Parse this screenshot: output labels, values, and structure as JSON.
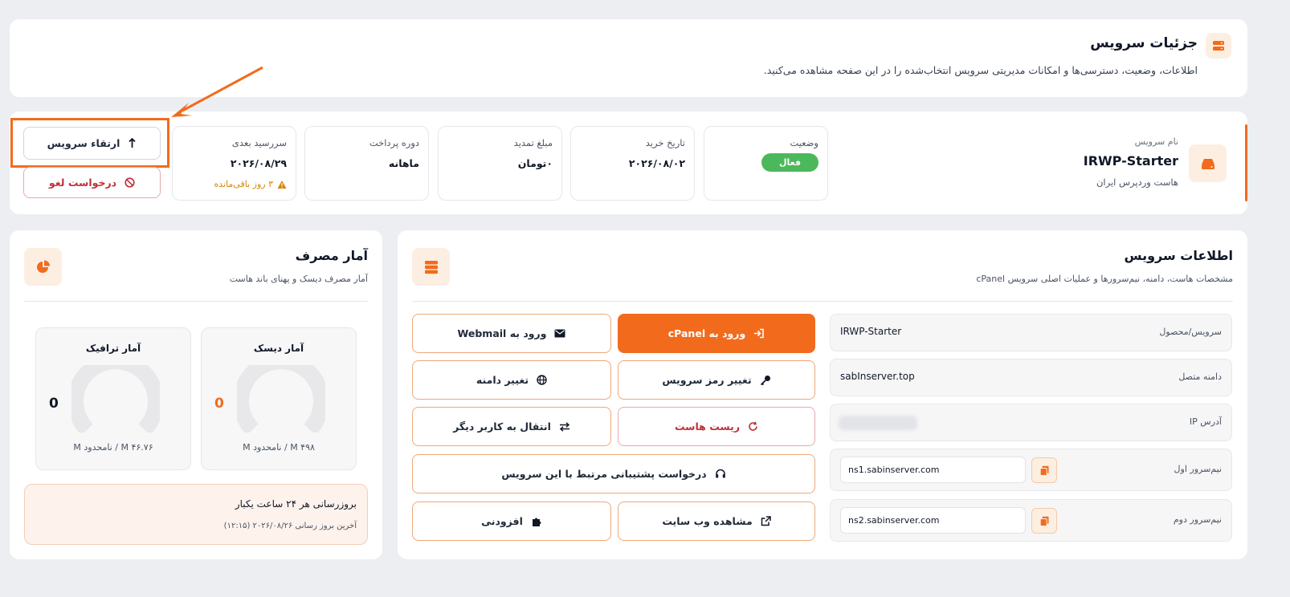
{
  "header": {
    "title": "جزئیات سرویس",
    "subtitle": "اطلاعات، وضعیت، دسترسی‌ها و امکانات مدیریتی سرویس انتخاب‌شده را در این صفحه مشاهده می‌کنید."
  },
  "service": {
    "name_label": "نام سرویس",
    "name": "IRWP-Starter",
    "type": "هاست وردپرس ایران",
    "status_label": "وضعیت",
    "status": "فعال",
    "purchase_label": "تاریخ خرید",
    "purchase_date": "۲۰۲۶/۰۸/۰۲",
    "renew_label": "مبلغ تمدید",
    "renew_amount": "۰تومان",
    "period_label": "دوره پرداخت",
    "period": "ماهانه",
    "due_label": "سررسید بعدی",
    "due_date": "۲۰۲۶/۰۸/۲۹",
    "days_left": "۳ روز باقی‌مانده",
    "upgrade_label": "ارتقاء سرویس",
    "cancel_label": "درخواست لغو"
  },
  "info_panel": {
    "title": "اطلاعات سرویس",
    "subtitle": "مشخصات هاست، دامنه، نیم‌سرورها و عملیات اصلی سرویس cPanel",
    "rows": [
      {
        "label": "سرویس/محصول",
        "value": "IRWP-Starter"
      },
      {
        "label": "دامنه متصل",
        "value": "sabInserver.top"
      },
      {
        "label": "آدرس IP",
        "value": ""
      },
      {
        "label": "نیم‌سرور اول",
        "value": "ns1.sabinserver.com"
      },
      {
        "label": "نیم‌سرور دوم",
        "value": "ns2.sabinserver.com"
      }
    ],
    "buttons": {
      "cpanel": "ورود به cPanel",
      "webmail": "ورود به Webmail",
      "change_password": "تغییر رمز سرویس",
      "change_domain": "تغییر دامنه",
      "reset_host": "ریست هاست",
      "transfer": "انتقال به کاربر دیگر",
      "support": "درخواست پشتیبانی مرتبط با این سرویس",
      "view_site": "مشاهده وب سایت",
      "addons": "افزودنی"
    }
  },
  "usage_panel": {
    "title": "آمار مصرف",
    "subtitle": "آمار مصرف دیسک و پهنای باند هاست",
    "disk": {
      "title": "آمار دیسک",
      "value": "0",
      "detail": "M ۴۹۸ / نامحدود M",
      "fraction": 0
    },
    "traffic": {
      "title": "آمار ترافیک",
      "value": "0",
      "detail": "M ۴۶.۷۶ / نامحدود M",
      "fraction": 0
    },
    "update_title": "بروزرسانی هر ۲۴ ساعت یکبار",
    "update_detail": "آخرین بروز رسانی ۲۰۲۶/۰۸/۲۶ (۱۲:۱۵)"
  },
  "colors": {
    "accent": "#f26b1d",
    "success": "#4cb85c",
    "danger": "#c0303a",
    "warning": "#d4860b"
  }
}
